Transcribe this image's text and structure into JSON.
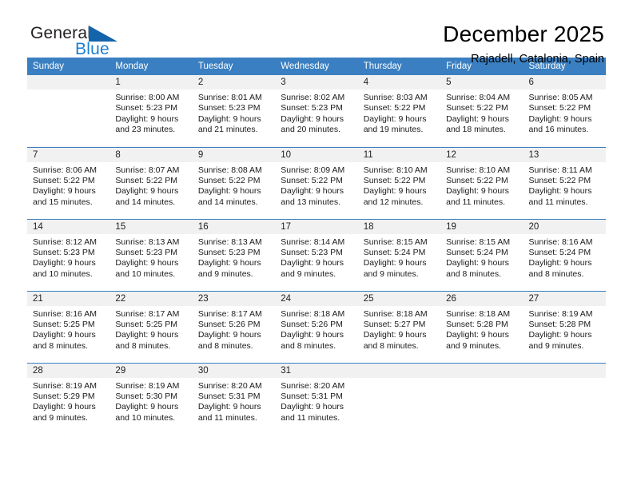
{
  "brand": {
    "name_part1": "General",
    "name_part2": "Blue"
  },
  "header": {
    "title": "December 2025",
    "subtitle": "Rajadell, Catalonia, Spain"
  },
  "weekdays": [
    "Sunday",
    "Monday",
    "Tuesday",
    "Wednesday",
    "Thursday",
    "Friday",
    "Saturday"
  ],
  "colors": {
    "header_band": "#3a7fc1",
    "daynum_band": "#f1f1f1",
    "brand_blue": "#1c7fd0",
    "triangle_blue": "#1464ab"
  },
  "labels": {
    "sunrise_prefix": "Sunrise: ",
    "sunset_prefix": "Sunset: ",
    "daylight_prefix": "Daylight: "
  },
  "weeks": [
    [
      {
        "day": "",
        "sunrise": "",
        "sunset": "",
        "daylight_line1": "",
        "daylight_line2": ""
      },
      {
        "day": "1",
        "sunrise": "Sunrise: 8:00 AM",
        "sunset": "Sunset: 5:23 PM",
        "daylight_line1": "Daylight: 9 hours",
        "daylight_line2": "and 23 minutes."
      },
      {
        "day": "2",
        "sunrise": "Sunrise: 8:01 AM",
        "sunset": "Sunset: 5:23 PM",
        "daylight_line1": "Daylight: 9 hours",
        "daylight_line2": "and 21 minutes."
      },
      {
        "day": "3",
        "sunrise": "Sunrise: 8:02 AM",
        "sunset": "Sunset: 5:23 PM",
        "daylight_line1": "Daylight: 9 hours",
        "daylight_line2": "and 20 minutes."
      },
      {
        "day": "4",
        "sunrise": "Sunrise: 8:03 AM",
        "sunset": "Sunset: 5:22 PM",
        "daylight_line1": "Daylight: 9 hours",
        "daylight_line2": "and 19 minutes."
      },
      {
        "day": "5",
        "sunrise": "Sunrise: 8:04 AM",
        "sunset": "Sunset: 5:22 PM",
        "daylight_line1": "Daylight: 9 hours",
        "daylight_line2": "and 18 minutes."
      },
      {
        "day": "6",
        "sunrise": "Sunrise: 8:05 AM",
        "sunset": "Sunset: 5:22 PM",
        "daylight_line1": "Daylight: 9 hours",
        "daylight_line2": "and 16 minutes."
      }
    ],
    [
      {
        "day": "7",
        "sunrise": "Sunrise: 8:06 AM",
        "sunset": "Sunset: 5:22 PM",
        "daylight_line1": "Daylight: 9 hours",
        "daylight_line2": "and 15 minutes."
      },
      {
        "day": "8",
        "sunrise": "Sunrise: 8:07 AM",
        "sunset": "Sunset: 5:22 PM",
        "daylight_line1": "Daylight: 9 hours",
        "daylight_line2": "and 14 minutes."
      },
      {
        "day": "9",
        "sunrise": "Sunrise: 8:08 AM",
        "sunset": "Sunset: 5:22 PM",
        "daylight_line1": "Daylight: 9 hours",
        "daylight_line2": "and 14 minutes."
      },
      {
        "day": "10",
        "sunrise": "Sunrise: 8:09 AM",
        "sunset": "Sunset: 5:22 PM",
        "daylight_line1": "Daylight: 9 hours",
        "daylight_line2": "and 13 minutes."
      },
      {
        "day": "11",
        "sunrise": "Sunrise: 8:10 AM",
        "sunset": "Sunset: 5:22 PM",
        "daylight_line1": "Daylight: 9 hours",
        "daylight_line2": "and 12 minutes."
      },
      {
        "day": "12",
        "sunrise": "Sunrise: 8:10 AM",
        "sunset": "Sunset: 5:22 PM",
        "daylight_line1": "Daylight: 9 hours",
        "daylight_line2": "and 11 minutes."
      },
      {
        "day": "13",
        "sunrise": "Sunrise: 8:11 AM",
        "sunset": "Sunset: 5:22 PM",
        "daylight_line1": "Daylight: 9 hours",
        "daylight_line2": "and 11 minutes."
      }
    ],
    [
      {
        "day": "14",
        "sunrise": "Sunrise: 8:12 AM",
        "sunset": "Sunset: 5:23 PM",
        "daylight_line1": "Daylight: 9 hours",
        "daylight_line2": "and 10 minutes."
      },
      {
        "day": "15",
        "sunrise": "Sunrise: 8:13 AM",
        "sunset": "Sunset: 5:23 PM",
        "daylight_line1": "Daylight: 9 hours",
        "daylight_line2": "and 10 minutes."
      },
      {
        "day": "16",
        "sunrise": "Sunrise: 8:13 AM",
        "sunset": "Sunset: 5:23 PM",
        "daylight_line1": "Daylight: 9 hours",
        "daylight_line2": "and 9 minutes."
      },
      {
        "day": "17",
        "sunrise": "Sunrise: 8:14 AM",
        "sunset": "Sunset: 5:23 PM",
        "daylight_line1": "Daylight: 9 hours",
        "daylight_line2": "and 9 minutes."
      },
      {
        "day": "18",
        "sunrise": "Sunrise: 8:15 AM",
        "sunset": "Sunset: 5:24 PM",
        "daylight_line1": "Daylight: 9 hours",
        "daylight_line2": "and 9 minutes."
      },
      {
        "day": "19",
        "sunrise": "Sunrise: 8:15 AM",
        "sunset": "Sunset: 5:24 PM",
        "daylight_line1": "Daylight: 9 hours",
        "daylight_line2": "and 8 minutes."
      },
      {
        "day": "20",
        "sunrise": "Sunrise: 8:16 AM",
        "sunset": "Sunset: 5:24 PM",
        "daylight_line1": "Daylight: 9 hours",
        "daylight_line2": "and 8 minutes."
      }
    ],
    [
      {
        "day": "21",
        "sunrise": "Sunrise: 8:16 AM",
        "sunset": "Sunset: 5:25 PM",
        "daylight_line1": "Daylight: 9 hours",
        "daylight_line2": "and 8 minutes."
      },
      {
        "day": "22",
        "sunrise": "Sunrise: 8:17 AM",
        "sunset": "Sunset: 5:25 PM",
        "daylight_line1": "Daylight: 9 hours",
        "daylight_line2": "and 8 minutes."
      },
      {
        "day": "23",
        "sunrise": "Sunrise: 8:17 AM",
        "sunset": "Sunset: 5:26 PM",
        "daylight_line1": "Daylight: 9 hours",
        "daylight_line2": "and 8 minutes."
      },
      {
        "day": "24",
        "sunrise": "Sunrise: 8:18 AM",
        "sunset": "Sunset: 5:26 PM",
        "daylight_line1": "Daylight: 9 hours",
        "daylight_line2": "and 8 minutes."
      },
      {
        "day": "25",
        "sunrise": "Sunrise: 8:18 AM",
        "sunset": "Sunset: 5:27 PM",
        "daylight_line1": "Daylight: 9 hours",
        "daylight_line2": "and 8 minutes."
      },
      {
        "day": "26",
        "sunrise": "Sunrise: 8:18 AM",
        "sunset": "Sunset: 5:28 PM",
        "daylight_line1": "Daylight: 9 hours",
        "daylight_line2": "and 9 minutes."
      },
      {
        "day": "27",
        "sunrise": "Sunrise: 8:19 AM",
        "sunset": "Sunset: 5:28 PM",
        "daylight_line1": "Daylight: 9 hours",
        "daylight_line2": "and 9 minutes."
      }
    ],
    [
      {
        "day": "28",
        "sunrise": "Sunrise: 8:19 AM",
        "sunset": "Sunset: 5:29 PM",
        "daylight_line1": "Daylight: 9 hours",
        "daylight_line2": "and 9 minutes."
      },
      {
        "day": "29",
        "sunrise": "Sunrise: 8:19 AM",
        "sunset": "Sunset: 5:30 PM",
        "daylight_line1": "Daylight: 9 hours",
        "daylight_line2": "and 10 minutes."
      },
      {
        "day": "30",
        "sunrise": "Sunrise: 8:20 AM",
        "sunset": "Sunset: 5:31 PM",
        "daylight_line1": "Daylight: 9 hours",
        "daylight_line2": "and 11 minutes."
      },
      {
        "day": "31",
        "sunrise": "Sunrise: 8:20 AM",
        "sunset": "Sunset: 5:31 PM",
        "daylight_line1": "Daylight: 9 hours",
        "daylight_line2": "and 11 minutes."
      },
      {
        "day": "",
        "sunrise": "",
        "sunset": "",
        "daylight_line1": "",
        "daylight_line2": ""
      },
      {
        "day": "",
        "sunrise": "",
        "sunset": "",
        "daylight_line1": "",
        "daylight_line2": ""
      },
      {
        "day": "",
        "sunrise": "",
        "sunset": "",
        "daylight_line1": "",
        "daylight_line2": ""
      }
    ]
  ]
}
